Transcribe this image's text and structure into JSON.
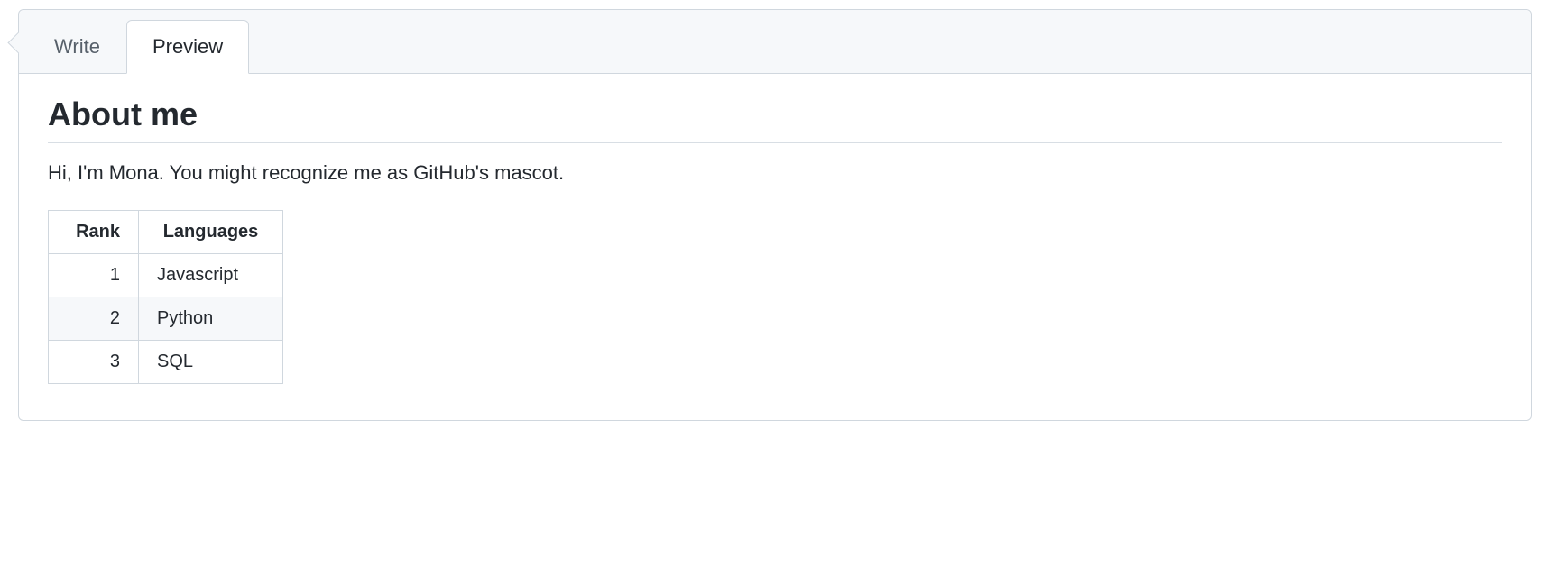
{
  "tabs": {
    "write": "Write",
    "preview": "Preview"
  },
  "content": {
    "heading": "About me",
    "intro": "Hi, I'm Mona. You might recognize me as GitHub's mascot.",
    "table": {
      "headers": {
        "rank": "Rank",
        "languages": "Languages"
      },
      "rows": [
        {
          "rank": "1",
          "language": "Javascript"
        },
        {
          "rank": "2",
          "language": "Python"
        },
        {
          "rank": "3",
          "language": "SQL"
        }
      ]
    }
  }
}
